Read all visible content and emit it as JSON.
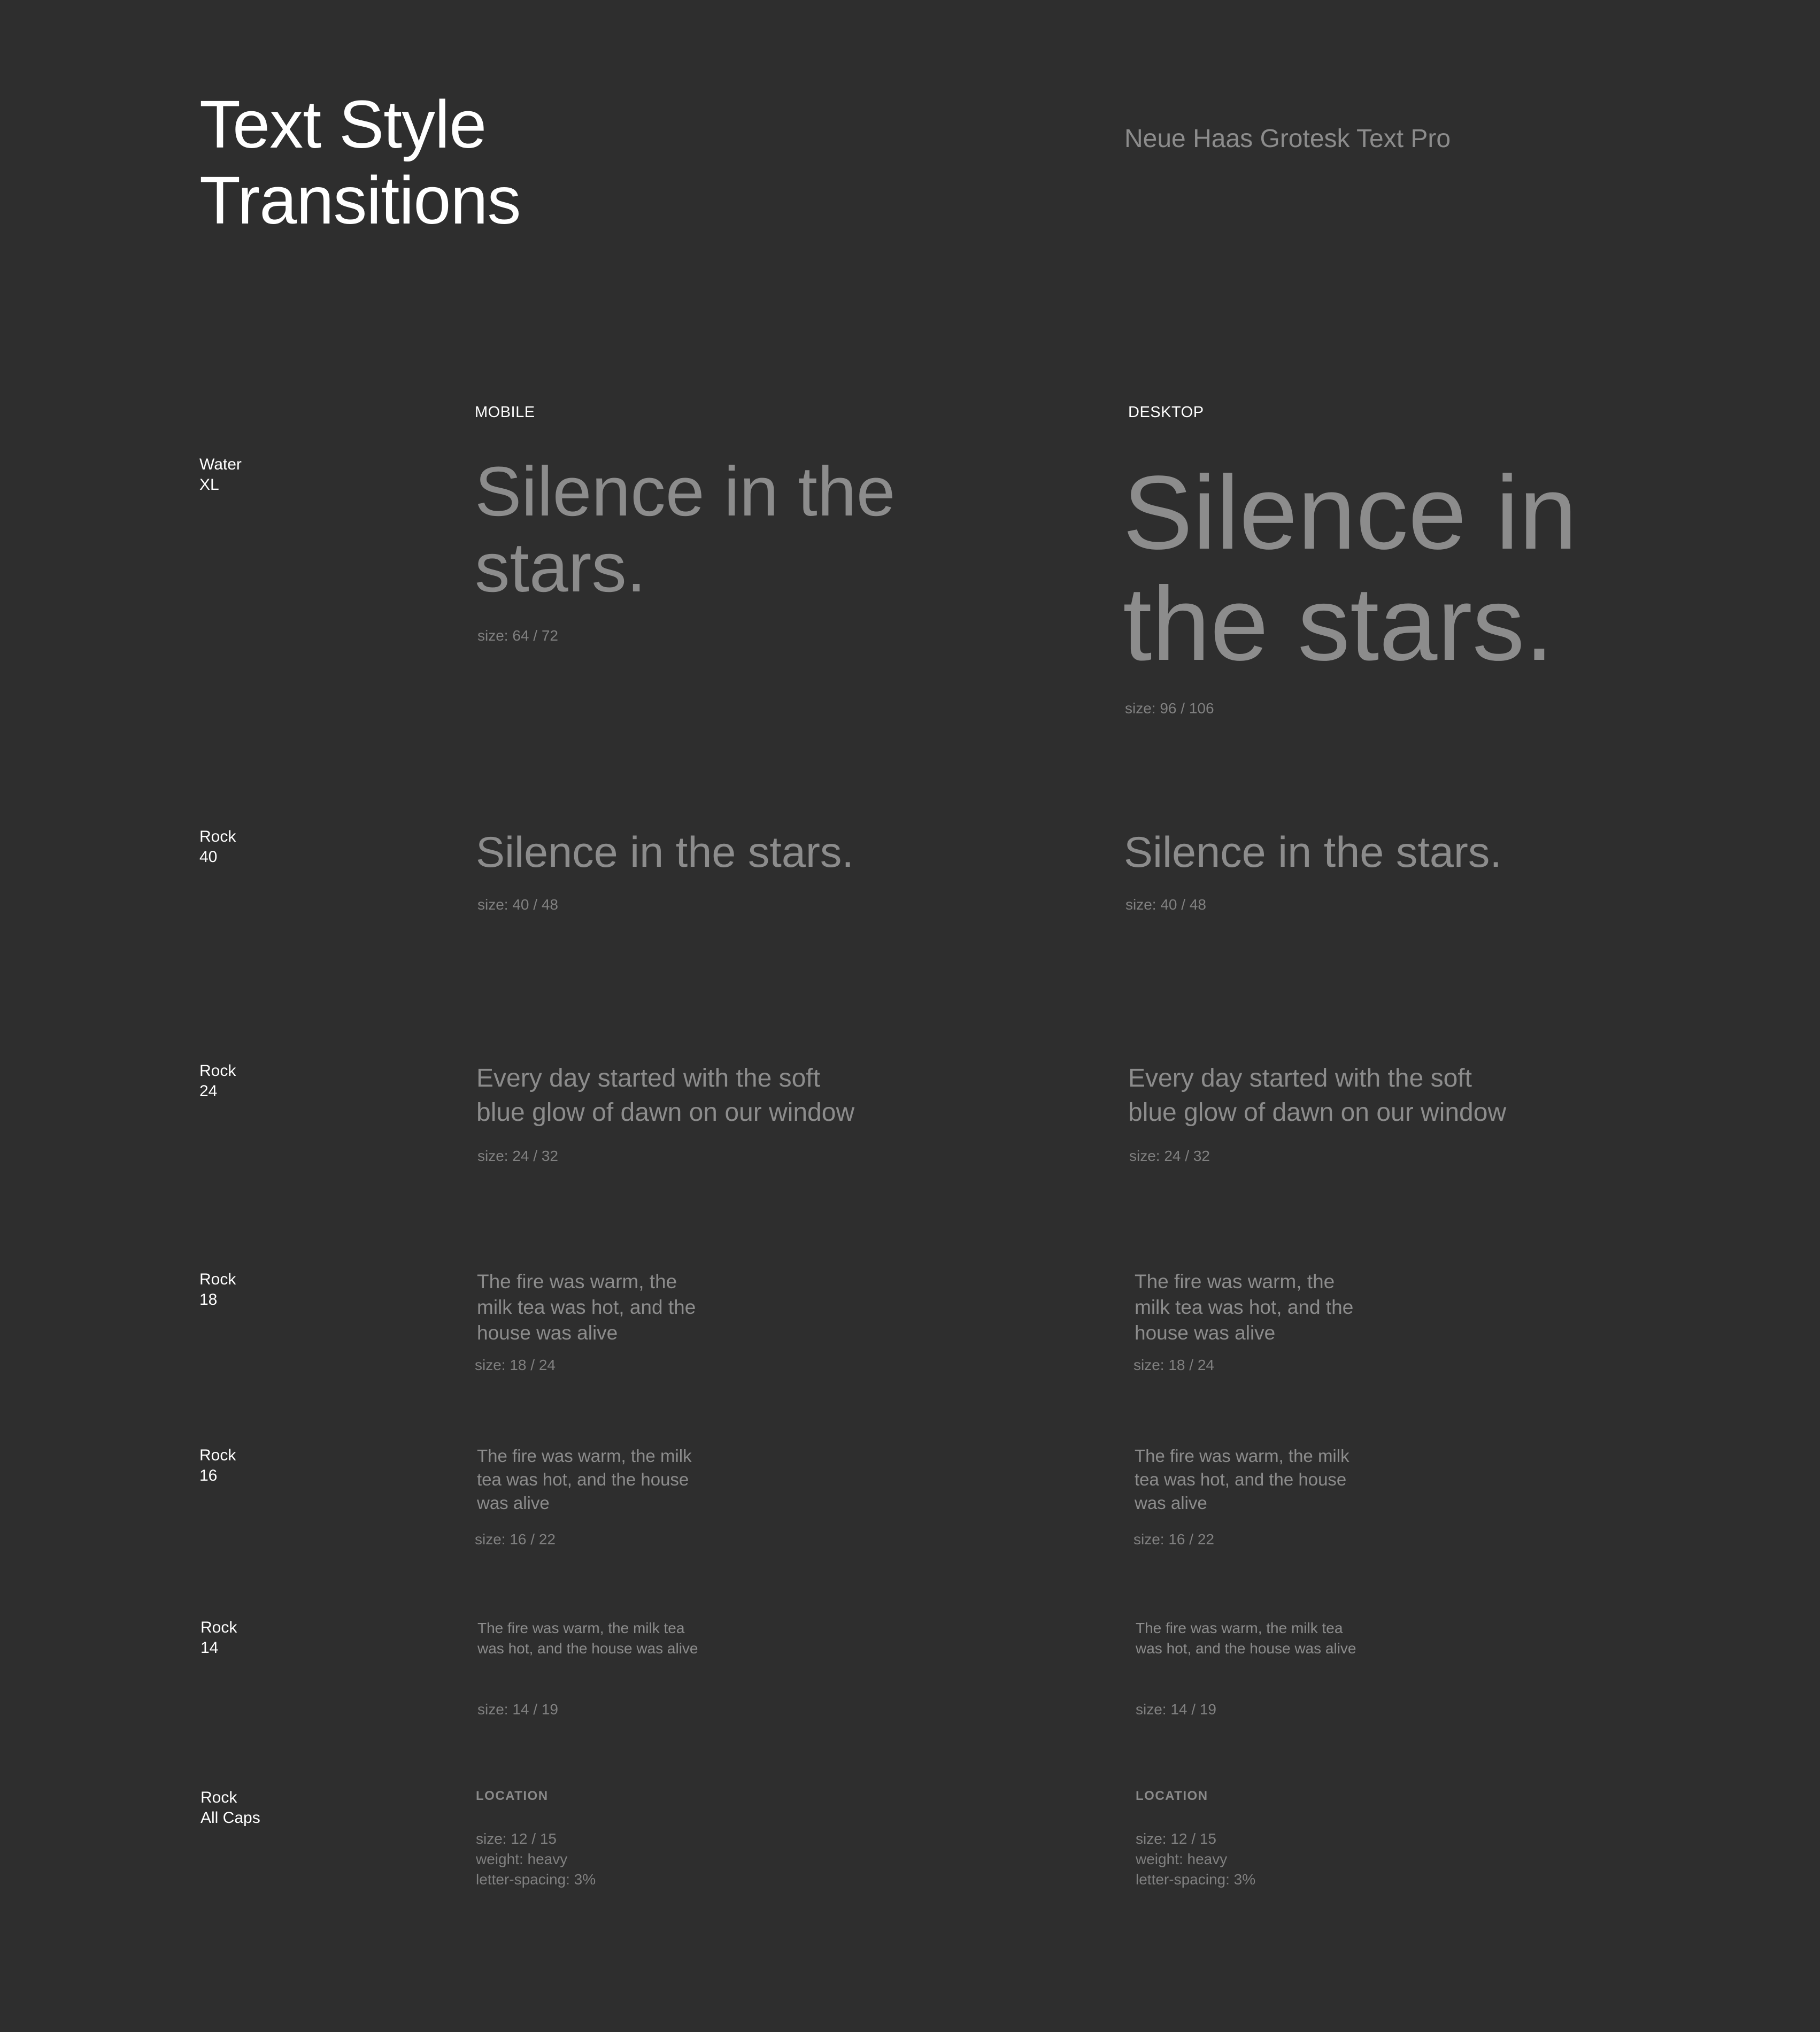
{
  "header": {
    "title": "Text Style\nTransitions",
    "font_name": "Neue Haas Grotesk Text Pro"
  },
  "columns": {
    "mobile": "MOBILE",
    "desktop": "DESKTOP"
  },
  "colors": {
    "background": "#2e2e2e",
    "heading": "#ffffff",
    "sample_text": "#8c8c8c"
  },
  "rows": [
    {
      "label": "Water\nXL",
      "mobile": {
        "text": "Silence in the\nstars.",
        "meta": "size: 64 / 72"
      },
      "desktop": {
        "text": "Silence in\nthe stars.",
        "meta": "size: 96 / 106"
      }
    },
    {
      "label": "Rock\n40",
      "mobile": {
        "text": "Silence in the stars.",
        "meta": "size: 40 / 48"
      },
      "desktop": {
        "text": "Silence in the stars.",
        "meta": "size: 40 / 48"
      }
    },
    {
      "label": "Rock\n24",
      "mobile": {
        "text": "Every day started with the soft\nblue glow of dawn on our window",
        "meta": "size: 24 / 32"
      },
      "desktop": {
        "text": "Every day started with the soft\nblue glow of dawn on our window",
        "meta": "size: 24 / 32"
      }
    },
    {
      "label": "Rock\n18",
      "mobile": {
        "text": "The fire was warm, the\nmilk tea was hot, and the\nhouse was alive",
        "meta": "size: 18 / 24"
      },
      "desktop": {
        "text": "The fire was warm, the\nmilk tea was hot, and the\nhouse was alive",
        "meta": "size: 18 / 24"
      }
    },
    {
      "label": "Rock\n16",
      "mobile": {
        "text": "The fire was warm, the milk\ntea was hot, and the house\nwas alive",
        "meta": "size: 16 / 22"
      },
      "desktop": {
        "text": "The fire was warm, the milk\ntea was hot, and the house\nwas alive",
        "meta": "size: 16 / 22"
      }
    },
    {
      "label": "Rock\n14",
      "mobile": {
        "text": "The fire was warm, the milk tea\nwas hot, and the house was alive",
        "meta": "size: 14 / 19"
      },
      "desktop": {
        "text": "The fire was warm, the milk tea\nwas hot, and the house was alive",
        "meta": "size: 14 / 19"
      }
    },
    {
      "label": "Rock\nAll Caps",
      "mobile": {
        "text": "LOCATION",
        "meta": "size: 12 / 15\nweight: heavy\nletter-spacing: 3%"
      },
      "desktop": {
        "text": "LOCATION",
        "meta": "size: 12 / 15\nweight: heavy\nletter-spacing: 3%"
      }
    }
  ]
}
